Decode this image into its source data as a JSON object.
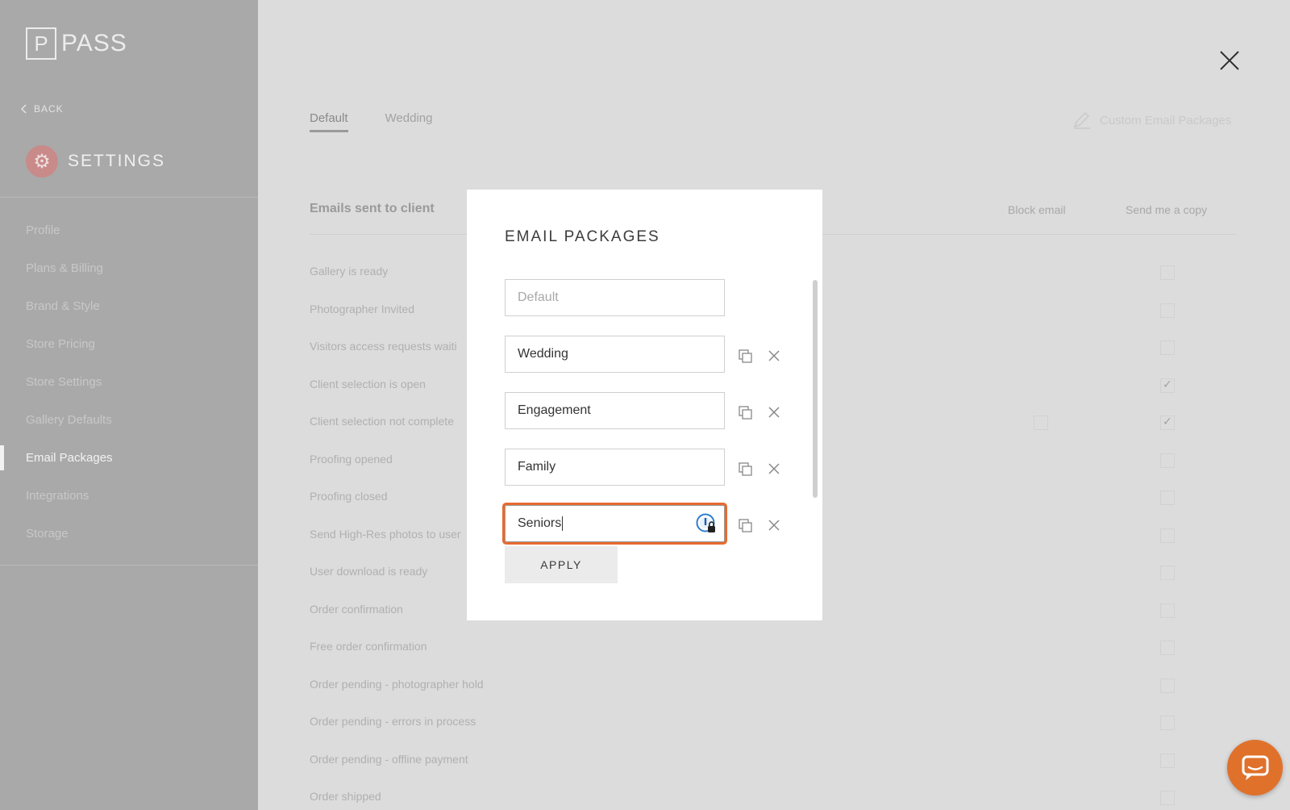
{
  "sidebar": {
    "logo_mark": "P",
    "logo_text": "PASS",
    "back_label": "BACK",
    "settings_title": "SETTINGS",
    "nav": [
      {
        "label": "Profile"
      },
      {
        "label": "Plans & Billing"
      },
      {
        "label": "Brand & Style"
      },
      {
        "label": "Store Pricing"
      },
      {
        "label": "Store Settings"
      },
      {
        "label": "Gallery Defaults"
      },
      {
        "label": "Email Packages",
        "active": true
      },
      {
        "label": "Integrations"
      },
      {
        "label": "Storage"
      }
    ]
  },
  "main": {
    "tabs": [
      {
        "label": "Default",
        "active": true
      },
      {
        "label": "Wedding"
      }
    ],
    "custom_packages_label": "Custom Email Packages",
    "emails_heading": "Emails sent to client",
    "col_block": "Block email",
    "col_copy": "Send me a copy",
    "emails": [
      {
        "label": "Gallery is ready",
        "copy": false
      },
      {
        "label": "Photographer Invited",
        "copy": false
      },
      {
        "label": "Visitors access requests waiti",
        "copy": false
      },
      {
        "label": "Client selection is open",
        "copy": true
      },
      {
        "label": "Client selection not complete",
        "copy": true
      },
      {
        "label": "Proofing opened",
        "copy": false
      },
      {
        "label": "Proofing closed",
        "copy": false
      },
      {
        "label": "Send High-Res photos to user",
        "copy": false
      },
      {
        "label": "User download is ready",
        "copy": false
      },
      {
        "label": "Order confirmation",
        "copy": false
      },
      {
        "label": "Free order confirmation",
        "copy": false
      },
      {
        "label": "Order pending - photographer hold",
        "copy": false
      },
      {
        "label": "Order pending - errors in process",
        "copy": false
      },
      {
        "label": "Order pending - offline payment",
        "copy": false
      },
      {
        "label": "Order shipped",
        "copy": false
      }
    ]
  },
  "modal": {
    "title": "EMAIL PACKAGES",
    "packages": [
      {
        "value": "",
        "placeholder": "Default"
      },
      {
        "value": "Wedding"
      },
      {
        "value": "Engagement"
      },
      {
        "value": "Family"
      },
      {
        "value": "Seniors",
        "focused": true
      }
    ],
    "apply_label": "APPLY"
  },
  "colors": {
    "accent": "#e86a2f",
    "chat": "#e0712b"
  }
}
